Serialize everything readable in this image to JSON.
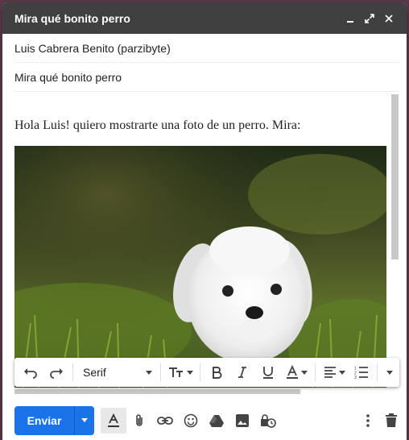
{
  "window": {
    "title": "Mira qué bonito perro"
  },
  "fields": {
    "to": "Luis Cabrera Benito (parzibyte)",
    "subject": "Mira qué bonito perro"
  },
  "message": {
    "text": "Hola Luis! quiero mostrarte una foto de un perro. Mira:"
  },
  "formatting": {
    "font": "Serif"
  },
  "actions": {
    "send_label": "Enviar"
  },
  "colors": {
    "titlebar": "#404040",
    "send": "#1a73e8"
  },
  "icons": [
    "minimize-icon",
    "expand-icon",
    "close-icon",
    "undo-icon",
    "redo-icon",
    "text-size-icon",
    "bold-icon",
    "italic-icon",
    "underline-icon",
    "text-color-icon",
    "align-icon",
    "numbered-list-icon",
    "more-formatting-icon",
    "formatting-options-icon",
    "attach-icon",
    "link-icon",
    "emoji-icon",
    "drive-icon",
    "photo-icon",
    "confidential-icon",
    "more-options-icon",
    "delete-icon"
  ]
}
